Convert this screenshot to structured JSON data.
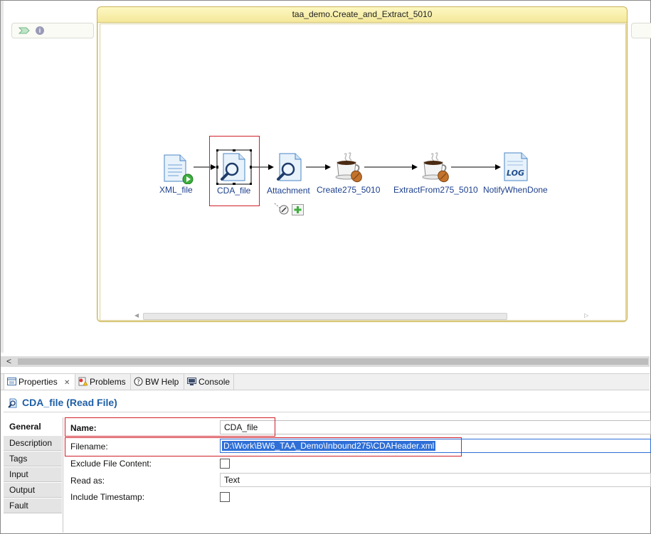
{
  "canvas": {
    "process_title": "taa_demo.Create_and_Extract_5010",
    "info_glyph": "i",
    "activities": [
      {
        "label": "XML_file",
        "icon": "xml-file-start-icon"
      },
      {
        "label": "CDA_file",
        "icon": "read-file-magnifier-icon"
      },
      {
        "label": "Attachment",
        "icon": "read-file-magnifier-icon"
      },
      {
        "label": "Create275_5010",
        "icon": "java-coffee-cup-icon"
      },
      {
        "label": "ExtractFrom275_5010",
        "icon": "java-coffee-cup-icon"
      },
      {
        "label": "NotifyWhenDone",
        "icon": "log-icon"
      }
    ],
    "log_badge": "LOG"
  },
  "bottom_scroll": {
    "left_arrow": "<"
  },
  "tabs": [
    {
      "label": "Properties",
      "close": "✕"
    },
    {
      "label": "Problems"
    },
    {
      "label": "BW Help"
    },
    {
      "label": "Console"
    }
  ],
  "properties": {
    "title": "CDA_file (Read File)",
    "side_tabs": [
      "General",
      "Description",
      "Tags",
      "Input",
      "Output",
      "Fault"
    ],
    "name_label": "Name:",
    "name_value": "CDA_file",
    "filename_label": "Filename:",
    "filename_value": "D:\\Work\\BW6_TAA_Demo\\Inbound275\\CDAHeader.xml",
    "exclude_label": "Exclude File Content:",
    "read_as_label": "Read as:",
    "read_as_value": "Text",
    "timestamp_label": "Include Timestamp:"
  },
  "colors": {
    "accent_title": "#1f5fa6",
    "highlight_red": "#d0202a",
    "selection_blue": "#2e6fd7"
  }
}
